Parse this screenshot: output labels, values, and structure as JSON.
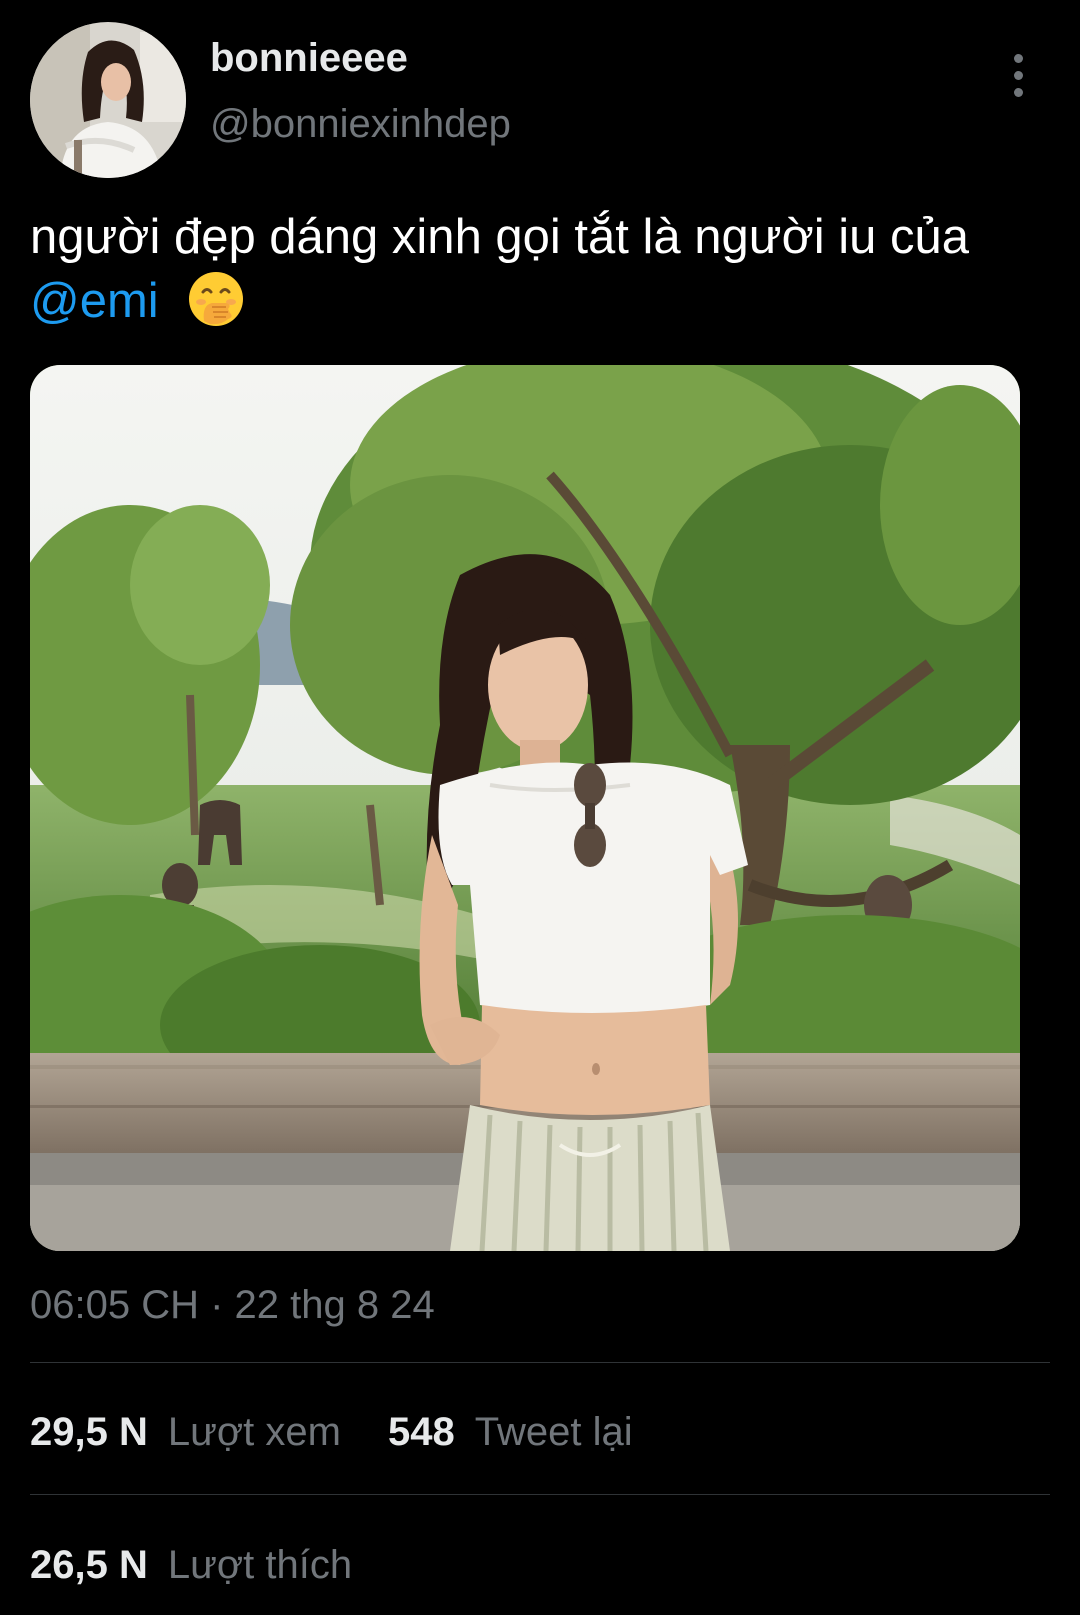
{
  "author": {
    "display_name": "bonnieeee",
    "handle": "@bonniexinhdep",
    "avatar": "profile-photo"
  },
  "menu_icon": "more-vertical-icon",
  "tweet": {
    "text": "người đẹp dáng xinh gọi tắt là người iu của",
    "mention": "@emi",
    "emoji": "face-with-hand-over-mouth"
  },
  "media": {
    "kind": "photo"
  },
  "timestamp": "06:05 CH · 22 thg 8 24",
  "stats": {
    "views_count": "29,5 N",
    "views_label": "Lượt xem",
    "retweets_count": "548",
    "retweets_label": "Tweet lại",
    "likes_count": "26,5 N",
    "likes_label": "Lượt thích"
  }
}
